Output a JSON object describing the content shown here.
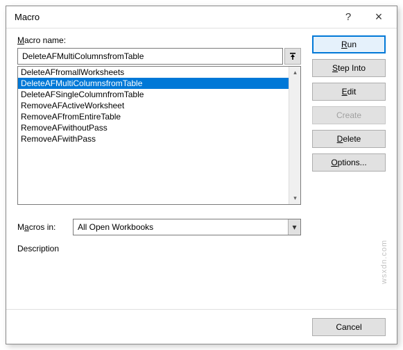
{
  "dialog": {
    "title": "Macro",
    "help_icon": "?",
    "close_icon": "×"
  },
  "macro_name": {
    "label_pre": "M",
    "label_post": "acro name:",
    "value": "DeleteAFMultiColumnsfromTable"
  },
  "list": {
    "items": [
      "DeleteAFfromallWorksheets",
      "DeleteAFMultiColumnsfromTable",
      "DeleteAFSingleColumnfromTable",
      "RemoveAFActiveWorksheet",
      "RemoveAFfromEntireTable",
      "RemoveAFwithoutPass",
      "RemoveAFwithPass"
    ],
    "selected_index": 1
  },
  "macros_in": {
    "label_pre": "M",
    "label_underline": "a",
    "label_post": "cros in:",
    "value": "All Open Workbooks"
  },
  "description": {
    "label": "Description"
  },
  "buttons": {
    "run": "Run",
    "step_into": "Step Into",
    "edit": "Edit",
    "create": "Create",
    "delete": "Delete",
    "options": "Options...",
    "cancel": "Cancel"
  },
  "watermark": "wsxdn.com"
}
